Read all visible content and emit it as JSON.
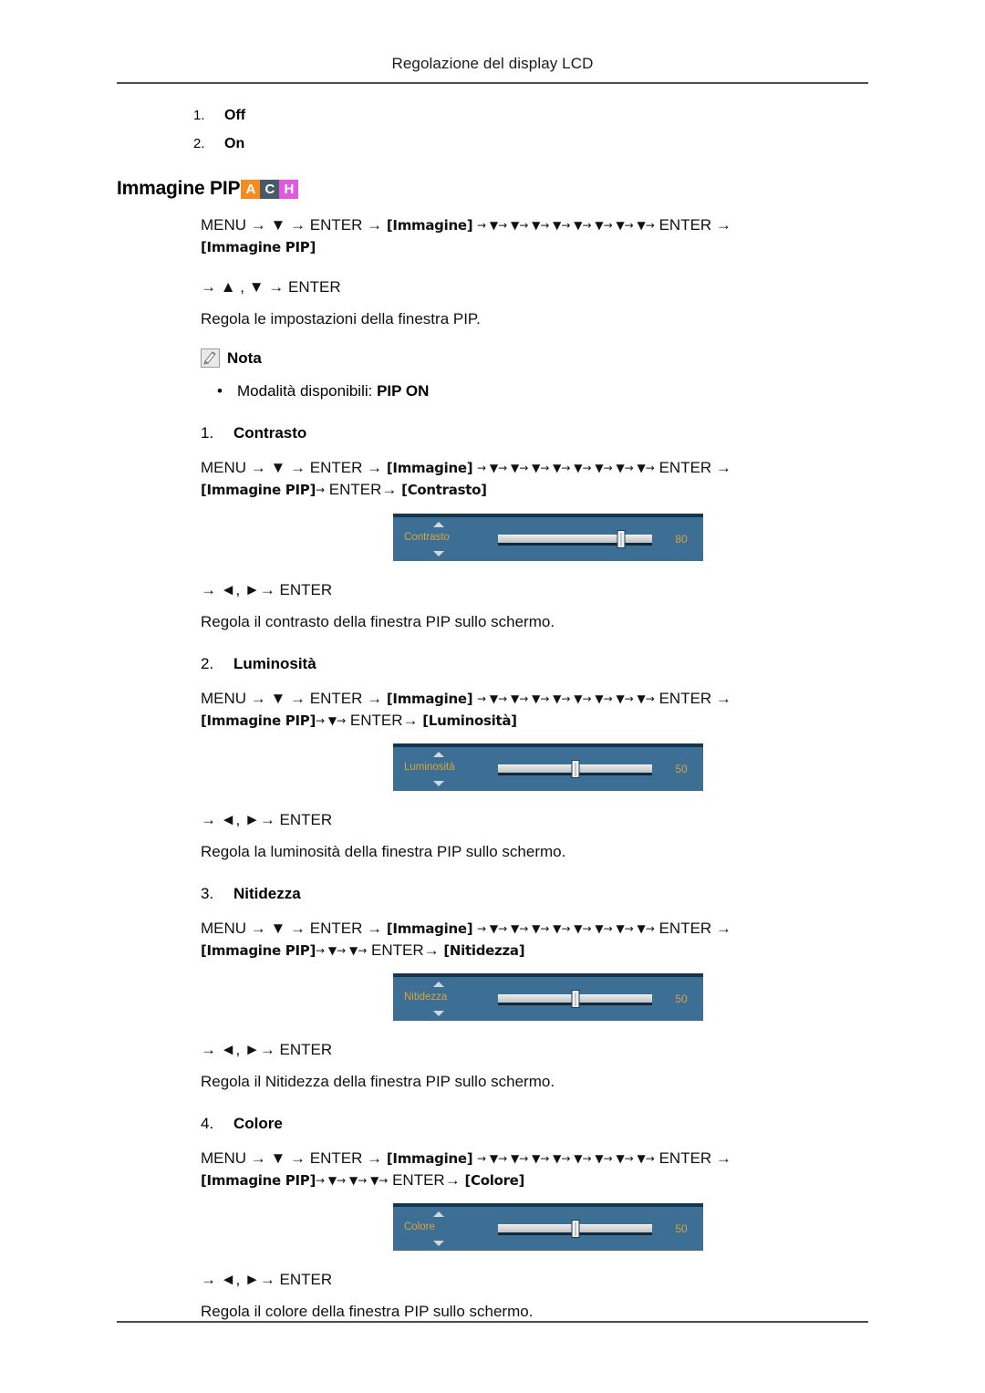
{
  "header": {
    "running_title": "Regolazione del display LCD"
  },
  "top_options": [
    {
      "num": "1.",
      "label": "Off"
    },
    {
      "num": "2.",
      "label": "On"
    }
  ],
  "section": {
    "title": "Immagine PIP",
    "badges": [
      {
        "letter": "A",
        "color": "#f68b1f"
      },
      {
        "letter": "C",
        "color": "#4a5a6a"
      },
      {
        "letter": "H",
        "color": "#e05ae0"
      }
    ],
    "nav_line_1": "MENU →  ▼  → ENTER →",
    "nav_token_immagine": "[Immagine]",
    "nav_arrows_mid": "→ ▼→ ▼→ ▼→ ▼→ ▼→ ▼→ ▼→ ▼→",
    "nav_enter_tail": "ENTER →",
    "nav_token_pip": "[Immagine PIP]",
    "nav_line_2": "→ ▲ , ▼ → ENTER",
    "description": "Regola le impostazioni della finestra PIP.",
    "nota_label": "Nota",
    "bullet_dot": "•",
    "bullet_prefix": "Modalità disponibili: ",
    "bullet_strong": "PIP ON"
  },
  "items": [
    {
      "num": "1.",
      "label": "Contrasto",
      "nav_line_1": "MENU →  ▼  → ENTER →",
      "token_immagine": "[Immagine]",
      "arrows_mid": "→ ▼→ ▼→ ▼→ ▼→ ▼→ ▼→ ▼→ ▼→",
      "enter_tail": "ENTER →",
      "token_pip": "[Immagine PIP]",
      "pip_arrows": "→",
      "pip_enter": "ENTER→",
      "token_item": "[Contrasto]",
      "osd": {
        "label": "Contrasto",
        "value": "80",
        "percent": 80,
        "up_icon": "triangle-up-icon",
        "down_icon": "triangle-down-icon"
      },
      "arrow_line": "→ ◄, ►→ ENTER",
      "description": "Regola il contrasto della finestra PIP sullo schermo."
    },
    {
      "num": "2.",
      "label": "Luminosità",
      "nav_line_1": "MENU →  ▼  → ENTER →",
      "token_immagine": "[Immagine]",
      "arrows_mid": "→ ▼→ ▼→ ▼→ ▼→ ▼→ ▼→ ▼→ ▼→",
      "enter_tail": "ENTER →",
      "token_pip": "[Immagine PIP]",
      "pip_arrows": "→ ▼→",
      "pip_enter": "ENTER→",
      "token_item": "[Luminosità]",
      "osd": {
        "label": "Luminosità",
        "value": "50",
        "percent": 50,
        "up_icon": "triangle-up-icon",
        "down_icon": "triangle-down-icon"
      },
      "arrow_line": "→ ◄, ►→ ENTER",
      "description": "Regola la luminosità della finestra PIP sullo schermo."
    },
    {
      "num": "3.",
      "label": "Nitidezza",
      "nav_line_1": "MENU →  ▼  → ENTER →",
      "token_immagine": "[Immagine]",
      "arrows_mid": "→ ▼→ ▼→ ▼→ ▼→ ▼→ ▼→ ▼→ ▼→",
      "enter_tail": "ENTER →",
      "token_pip": "[Immagine PIP]",
      "pip_arrows": "→ ▼→ ▼→",
      "pip_enter": "ENTER→",
      "token_item": "[Nitidezza]",
      "osd": {
        "label": "Nitidezza",
        "value": "50",
        "percent": 50,
        "up_icon": "triangle-up-icon",
        "down_icon": "triangle-down-icon"
      },
      "arrow_line": "→ ◄, ►→ ENTER",
      "description": "Regola il Nitidezza della finestra PIP sullo schermo."
    },
    {
      "num": "4.",
      "label": "Colore",
      "nav_line_1": "MENU →  ▼  → ENTER →",
      "token_immagine": "[Immagine]",
      "arrows_mid": "→ ▼→ ▼→ ▼→ ▼→ ▼→ ▼→ ▼→ ▼→",
      "enter_tail": "ENTER →",
      "token_pip": "[Immagine PIP]",
      "pip_arrows": "→ ▼→ ▼→ ▼→",
      "pip_enter": "ENTER→",
      "token_item": "[Colore]",
      "osd": {
        "label": "Colore",
        "value": "50",
        "percent": 50,
        "up_icon": "triangle-up-icon",
        "down_icon": "triangle-down-icon"
      },
      "arrow_line": "→ ◄, ►→ ENTER",
      "description": "Regola il colore della finestra PIP sullo schermo."
    }
  ]
}
